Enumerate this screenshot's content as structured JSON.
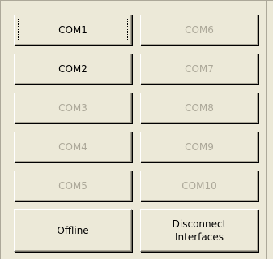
{
  "ports": {
    "left": [
      {
        "label": "COM1",
        "enabled": true,
        "focused": true
      },
      {
        "label": "COM2",
        "enabled": true,
        "focused": false
      },
      {
        "label": "COM3",
        "enabled": false,
        "focused": false
      },
      {
        "label": "COM4",
        "enabled": false,
        "focused": false
      },
      {
        "label": "COM5",
        "enabled": false,
        "focused": false
      }
    ],
    "right": [
      {
        "label": "COM6",
        "enabled": false
      },
      {
        "label": "COM7",
        "enabled": false
      },
      {
        "label": "COM8",
        "enabled": false
      },
      {
        "label": "COM9",
        "enabled": false
      },
      {
        "label": "COM10",
        "enabled": false
      }
    ]
  },
  "actions": {
    "offline_label": "Offline",
    "disconnect_label": "Disconnect\nInterfaces"
  }
}
